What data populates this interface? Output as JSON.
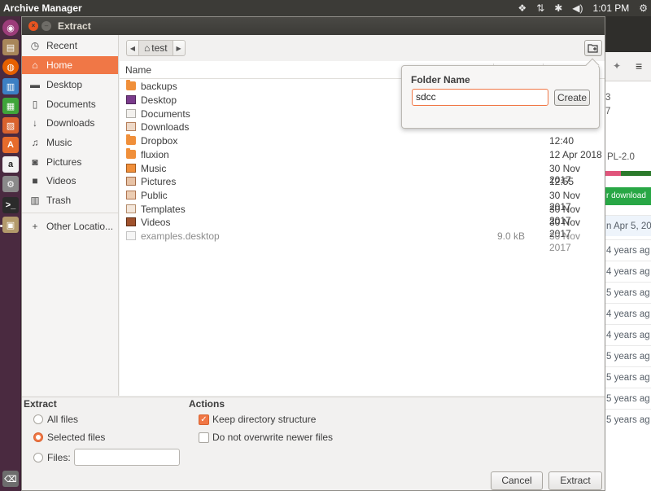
{
  "topbar": {
    "app_name": "Archive Manager",
    "clock": "1:01 PM"
  },
  "dialog": {
    "title": "Extract"
  },
  "sidebar": {
    "items": [
      {
        "label": "Recent",
        "icon": "clock-icon",
        "active": false
      },
      {
        "label": "Home",
        "icon": "home-icon",
        "active": true
      },
      {
        "label": "Desktop",
        "icon": "desktop-folder-icon",
        "active": false
      },
      {
        "label": "Documents",
        "icon": "document-icon",
        "active": false
      },
      {
        "label": "Downloads",
        "icon": "download-icon",
        "active": false
      },
      {
        "label": "Music",
        "icon": "music-icon",
        "active": false
      },
      {
        "label": "Pictures",
        "icon": "camera-icon",
        "active": false
      },
      {
        "label": "Videos",
        "icon": "video-icon",
        "active": false
      },
      {
        "label": "Trash",
        "icon": "trash-icon",
        "active": false
      },
      {
        "label": "Other Locatio...",
        "icon": "plus-icon",
        "active": false
      }
    ]
  },
  "pathbar": {
    "current": "test"
  },
  "filelist": {
    "column_name": "Name",
    "rows": [
      {
        "name": "backups",
        "size": "",
        "date": "",
        "icon": "folder-icon"
      },
      {
        "name": "Desktop",
        "size": "",
        "date": "",
        "icon": "desktop-folder-icon"
      },
      {
        "name": "Documents",
        "size": "",
        "date": "",
        "icon": "documents-folder-icon"
      },
      {
        "name": "Downloads",
        "size": "",
        "date": "",
        "icon": "downloads-folder-icon"
      },
      {
        "name": "Dropbox",
        "size": "",
        "date": "12:40",
        "icon": "folder-icon"
      },
      {
        "name": "fluxion",
        "size": "",
        "date": "12 Apr 2018",
        "icon": "folder-icon"
      },
      {
        "name": "Music",
        "size": "",
        "date": "30 Nov 2017",
        "icon": "music-folder-icon"
      },
      {
        "name": "Pictures",
        "size": "",
        "date": "12:55",
        "icon": "pictures-folder-icon"
      },
      {
        "name": "Public",
        "size": "",
        "date": "30 Nov 2017",
        "icon": "public-folder-icon"
      },
      {
        "name": "Templates",
        "size": "",
        "date": "30 Nov 2017",
        "icon": "templates-folder-icon"
      },
      {
        "name": "Videos",
        "size": "",
        "date": "30 Nov 2017",
        "icon": "videos-folder-icon"
      },
      {
        "name": "examples.desktop",
        "size": "9.0 kB",
        "date": "30 Nov 2017",
        "icon": "file-icon"
      }
    ]
  },
  "popover": {
    "title": "Folder Name",
    "value": "sdcc",
    "create_label": "Create"
  },
  "options": {
    "extract_heading": "Extract",
    "all_files": "All files",
    "selected_files": "Selected files",
    "files_label": "Files:",
    "files_value": "",
    "actions_heading": "Actions",
    "keep_structure": "Keep directory structure",
    "no_overwrite": "Do not overwrite newer files",
    "selected_radio": "selected_files",
    "keep_structure_checked": true,
    "no_overwrite_checked": false
  },
  "buttons": {
    "cancel": "Cancel",
    "extract": "Extract"
  },
  "background_window": {
    "partial_texts": [
      "3",
      "7",
      "PL-2.0",
      "r download",
      "n Apr 5, 201",
      "4 years ag",
      "4 years ag",
      "5 years ag",
      "4 years ag",
      "4 years ag",
      "5 years ag",
      "5 years ag",
      "5 years ag",
      "5 years ag"
    ]
  },
  "colors": {
    "accent": "#f07746",
    "panel": "#3c3b37",
    "launcher": "#4a2a40"
  }
}
